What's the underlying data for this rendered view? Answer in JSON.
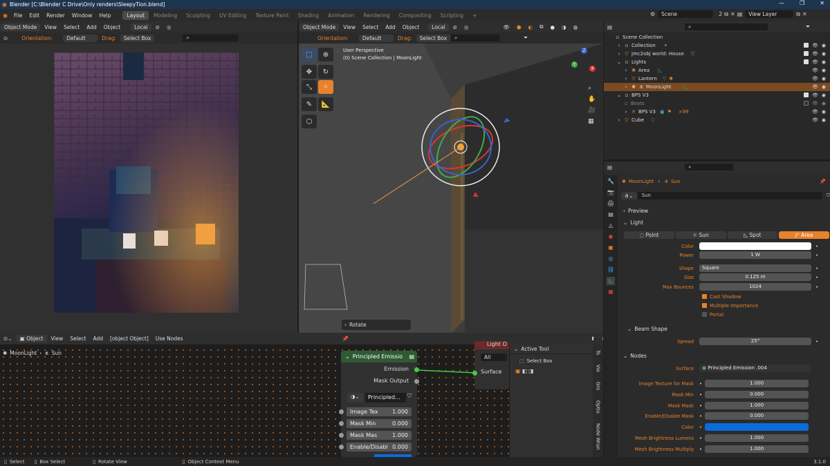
{
  "window": {
    "title": "Blender [C:\\Blender C Drive\\Only renders\\SleepyTion.blend]"
  },
  "menu": [
    "File",
    "Edit",
    "Render",
    "Window",
    "Help"
  ],
  "workspaces": [
    "Layout",
    "Modeling",
    "Sculpting",
    "UV Editing",
    "Texture Paint",
    "Shading",
    "Animation",
    "Rendering",
    "Compositing",
    "Scripting",
    "+"
  ],
  "scene": {
    "label": "Scene",
    "count": "2",
    "view_layer": "View Layer"
  },
  "left_header": {
    "mode": "Object Mode",
    "view": "View",
    "select": "Select",
    "add": "Add",
    "object": "Object",
    "transform": "Local",
    "orientation_label": "Orientation:",
    "orientation_value": "Default",
    "drag_label": "Drag:",
    "drag_value": "Select Box"
  },
  "viewport": {
    "mode": "Object Mode",
    "view": "View",
    "select": "Select",
    "add": "Add",
    "object": "Object",
    "transform": "Local",
    "orientation_label": "Orientation:",
    "orientation_value": "Default",
    "drag_label": "Drag:",
    "drag_value": "Select Box",
    "perspective": "User Perspective",
    "collection": "(0) Scene Collection | MoonLight",
    "last_op": "Rotate",
    "gizmo": {
      "x": "X",
      "y": "Y",
      "z": "Z"
    }
  },
  "outliner": {
    "rows": [
      {
        "label": "Scene Collection"
      },
      {
        "label": "Collection"
      },
      {
        "label": "jmc2obj world: House"
      },
      {
        "label": "Lights"
      },
      {
        "label": "Area"
      },
      {
        "label": "Lantern"
      },
      {
        "label": "MoonLight"
      },
      {
        "label": "BPS V3"
      },
      {
        "label": "Boots"
      },
      {
        "label": "BPS V3",
        "extra": "×99"
      },
      {
        "label": "Cube"
      }
    ]
  },
  "properties": {
    "breadcrumb": {
      "object": "MoonLight",
      "data": "Sun"
    },
    "datablock": "Sun",
    "sections": {
      "preview": "Preview",
      "light": "Light",
      "beam": "Beam Shape",
      "nodes": "Nodes"
    },
    "light_types": [
      "Point",
      "Sun",
      "Spot",
      "Area"
    ],
    "fields": {
      "color": "Color",
      "power_label": "Power",
      "power": "1 W",
      "shape_label": "Shape",
      "shape": "Square",
      "size_label": "Size",
      "size": "0.125 m",
      "bounces_label": "Max Bounces",
      "bounces": "1024",
      "cast_shadow": "Cast Shadow",
      "multi_importance": "Multiple Importance",
      "portal": "Portal",
      "spread_label": "Spread",
      "spread": "25°",
      "surface_label": "Surface",
      "surface": "Principled Emission .004"
    },
    "node_inputs": [
      {
        "label": "Image Texture for Mask",
        "value": "1.000"
      },
      {
        "label": "Mask Min",
        "value": "0.000"
      },
      {
        "label": "Mask Mask",
        "value": "1.000"
      },
      {
        "label": "Enable/Disable Mask",
        "value": "0.000"
      },
      {
        "label": "Color",
        "value": ""
      },
      {
        "label": "Mesh Brightness Lumens",
        "value": "1.000"
      },
      {
        "label": "Mesh Brightness Multiply",
        "value": "1.000"
      }
    ],
    "color_value": "#ffffff",
    "node_color": "#0a6cdc"
  },
  "node_editor": {
    "mode": "Object",
    "view": "View",
    "select": "Select",
    "add": "Add",
    "node": {
      "title": "Principled Emissio",
      "out1": "Emission",
      "out2": "Mask Output",
      "group": "Principled...",
      "rows": [
        {
          "label": "Image Tex",
          "value": "1.000"
        },
        {
          "label": "Mask Min",
          "value": "0.000"
        },
        {
          "label": "Mask Mas",
          "value": "1.000"
        },
        {
          "label": "Enable/Disabl",
          "value": "0.000"
        }
      ]
    },
    "use_nodes": "Use Nodes",
    "breadcrumb_obj": "MoonLight",
    "breadcrumb_data": "Sun",
    "output_node": {
      "title": "Light O",
      "target": "All",
      "socket": "Surface"
    },
    "side_panel": {
      "title": "Active Tool",
      "tool": "Select Box"
    },
    "side_tabs": [
      "To",
      "Vie",
      "Gro",
      "Optio",
      "Node Wran"
    ]
  },
  "status": {
    "select": "Select",
    "box_select": "Box Select",
    "rotate_view": "Rotate View",
    "context_menu": "Object Context Menu",
    "version": "3.1.0"
  }
}
